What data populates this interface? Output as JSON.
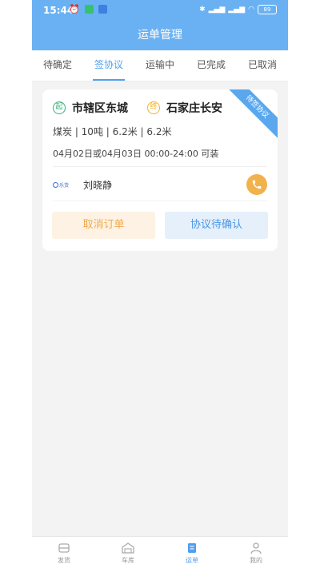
{
  "status_bar": {
    "time": "15:44",
    "battery": "89"
  },
  "header": {
    "title": "运单管理"
  },
  "tabs": [
    {
      "label": "待确定",
      "active": false
    },
    {
      "label": "签协议",
      "active": true
    },
    {
      "label": "运输中",
      "active": false
    },
    {
      "label": "已完成",
      "active": false
    },
    {
      "label": "已取消",
      "active": false
    }
  ],
  "order": {
    "badge": "待签协议",
    "start_marker": "起",
    "end_marker": "终",
    "origin": "市辖区东城",
    "destination": "石家庄长安",
    "cargo": "煤炭 | 10吨 | 6.2米 | 6.2米",
    "schedule": "04月02日或04月03日 00:00-24:00  可装",
    "contact_name": "刘晓静",
    "logo_text": "乐货",
    "cancel_label": "取消订单",
    "status_label": "协议待确认"
  },
  "tabbar": [
    {
      "label": "发货",
      "icon": "ship-goods-icon",
      "active": false
    },
    {
      "label": "车库",
      "icon": "garage-icon",
      "active": false
    },
    {
      "label": "运单",
      "icon": "waybill-icon",
      "active": true
    },
    {
      "label": "我的",
      "icon": "profile-icon",
      "active": false
    }
  ],
  "colors": {
    "primary": "#6ab1f3",
    "accent_blue": "#4ea2ee",
    "accent_orange": "#f2b24b"
  }
}
